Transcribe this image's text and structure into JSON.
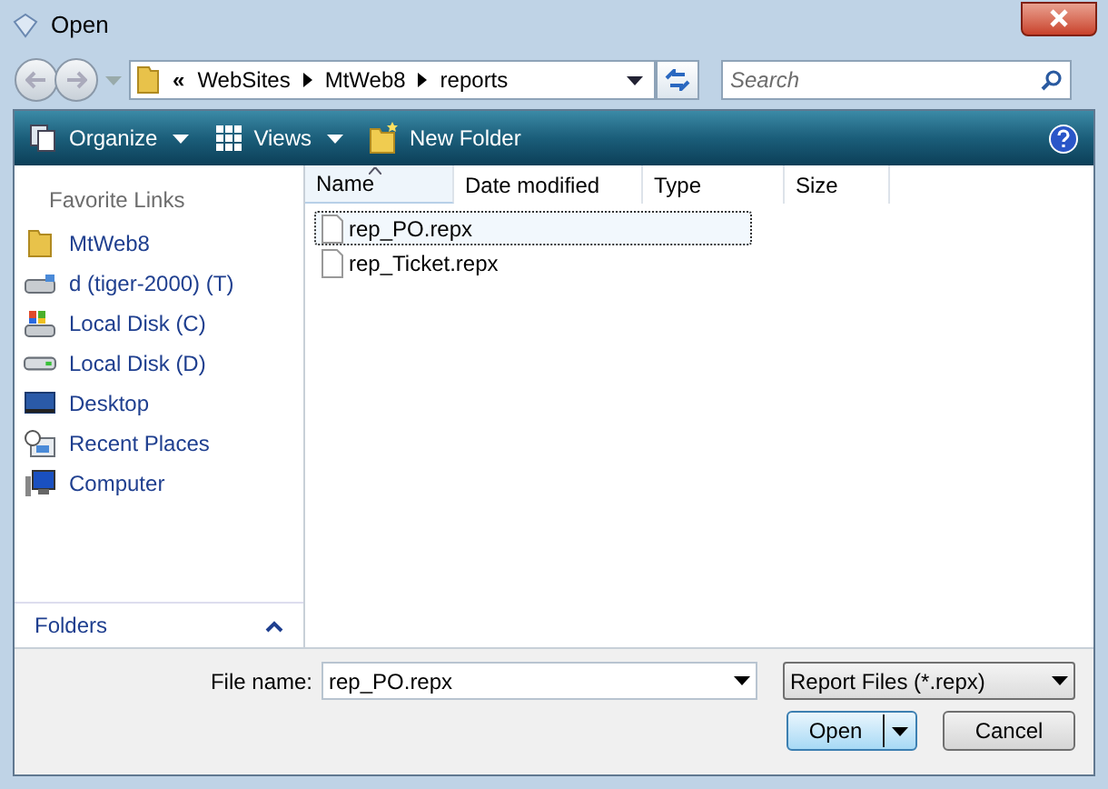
{
  "window": {
    "title": "Open"
  },
  "address": {
    "overflow": "«",
    "crumbs": [
      "WebSites",
      "MtWeb8",
      "reports"
    ]
  },
  "search": {
    "placeholder": "Search"
  },
  "toolbar": [
    {
      "label": "Organize",
      "kind": "organize"
    },
    {
      "label": "Views",
      "kind": "views"
    },
    {
      "label": "New Folder",
      "kind": "newfolder"
    }
  ],
  "sidebar": {
    "heading": "Favorite Links",
    "items": [
      {
        "label": "MtWeb8",
        "kind": "folder"
      },
      {
        "label": "d (tiger-2000) (T)",
        "kind": "netdrive"
      },
      {
        "label": "Local Disk (C)",
        "kind": "sysdrive"
      },
      {
        "label": "Local Disk (D)",
        "kind": "drive"
      },
      {
        "label": "Desktop",
        "kind": "desktop"
      },
      {
        "label": "Recent Places",
        "kind": "recent"
      },
      {
        "label": "Computer",
        "kind": "computer"
      }
    ],
    "folders": "Folders"
  },
  "columns": [
    "Name",
    "Date modified",
    "Type",
    "Size"
  ],
  "files": [
    {
      "name": "rep_PO.repx",
      "selected": true
    },
    {
      "name": "rep_Ticket.repx",
      "selected": false
    }
  ],
  "file_name": {
    "label": "File name:",
    "value": "rep_PO.repx"
  },
  "file_type": "Report Files (*.repx)",
  "buttons": [
    {
      "label": "Open",
      "kind": "split"
    },
    {
      "label": "Cancel",
      "kind": "plain"
    }
  ]
}
